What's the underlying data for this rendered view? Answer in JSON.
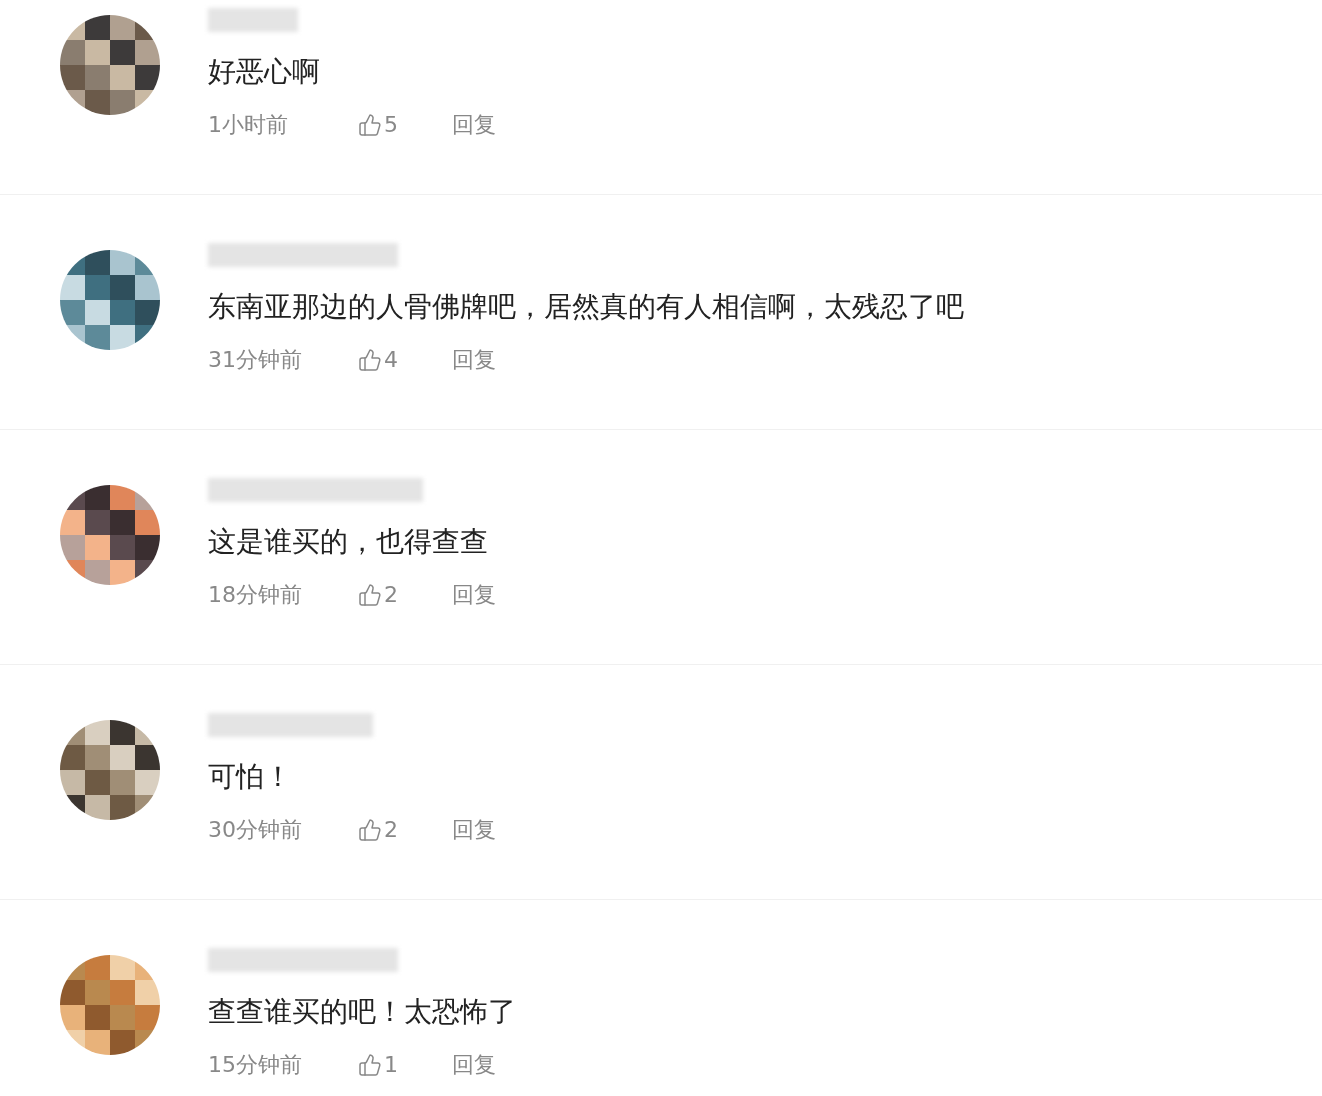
{
  "comments": [
    {
      "text": "好恶心啊",
      "time": "1小时前",
      "likes": "5",
      "reply": "回复"
    },
    {
      "text": "东南亚那边的人骨佛牌吧，居然真的有人相信啊，太残忍了吧",
      "time": "31分钟前",
      "likes": "4",
      "reply": "回复"
    },
    {
      "text": "这是谁买的，也得查查",
      "time": "18分钟前",
      "likes": "2",
      "reply": "回复"
    },
    {
      "text": "可怕！",
      "time": "30分钟前",
      "likes": "2",
      "reply": "回复"
    },
    {
      "text": "查查谁买的吧！太恐怖了",
      "time": "15分钟前",
      "likes": "1",
      "reply": "回复"
    }
  ]
}
